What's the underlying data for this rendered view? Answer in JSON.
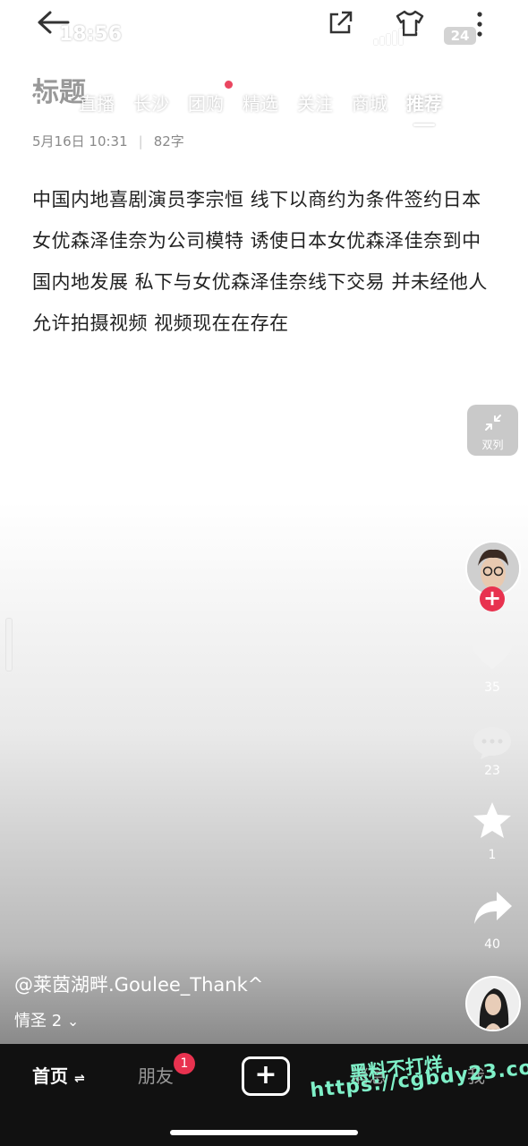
{
  "status": {
    "time": "18:56",
    "battery": "24"
  },
  "header": {
    "ghost_title": "标题",
    "tabs": [
      {
        "label": "直播"
      },
      {
        "label": "长沙"
      },
      {
        "label": "团购"
      },
      {
        "label": "精选"
      },
      {
        "label": "关注"
      },
      {
        "label": "商城"
      },
      {
        "label": "推荐"
      }
    ],
    "active_tab": "推荐",
    "tab_with_dot": "团购"
  },
  "post": {
    "date": "5月16日 10:31",
    "separator": "|",
    "word_count": "82字",
    "text": "中国内地喜剧演员李宗恒 线下以商约为条件签约日本女优森泽佳奈为公司模特 诱使日本女优森泽佳奈到中国内地发展 私下与女优森泽佳奈线下交易 并未经他人允许拍摄视频 视频现在在存在"
  },
  "rail": {
    "collapse_label": "双列",
    "likes": "35",
    "comments": "23",
    "favorites": "1",
    "shares": "40"
  },
  "author": {
    "handle": "@莱茵湖畔.Goulee_Thank^",
    "collection": "情圣 2",
    "collection_chevron": "⌄"
  },
  "nav": {
    "home": "首页",
    "home_suffix": "⇌",
    "friends": "朋友",
    "friends_badge": "1",
    "messages": "消息",
    "me": "我"
  },
  "watermark": {
    "line1": "黑料不打烊",
    "line2": "https://cgbdy23.com"
  },
  "colors": {
    "accent": "#e8324f",
    "watermark": "#7ff0c8",
    "nav_bg": "#111111"
  }
}
